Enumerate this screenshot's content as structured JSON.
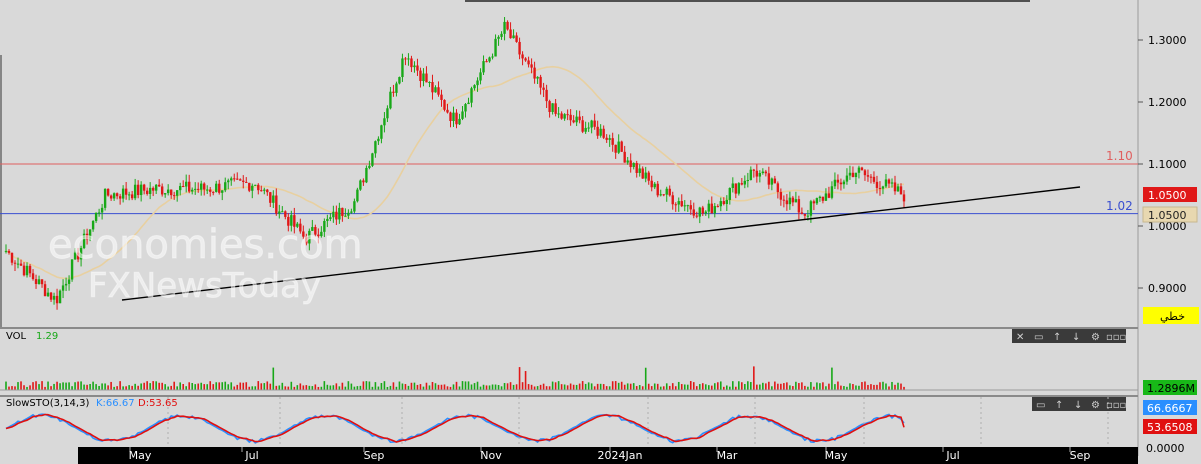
{
  "watermark": {
    "line1": "economies.com",
    "line2": "FXNewsToday"
  },
  "price_panel": {
    "ylim": [
      0.85,
      1.33
    ],
    "y_ticks": [
      "1.3000",
      "1.2000",
      "1.1000",
      "1.0000",
      "0.9000"
    ],
    "resistance": {
      "label": "1.10",
      "value": 1.1,
      "color": "#e06060"
    },
    "support": {
      "label": "1.02",
      "value": 1.02,
      "color": "#3a4fd0"
    },
    "last_price_badge": "1.0500",
    "last_price_badge2": "1.0500",
    "chart_type_button": "خطي"
  },
  "volume_panel": {
    "label": "VOL",
    "value": "1.29",
    "badge": "1.2896M"
  },
  "stoch_panel": {
    "label": "SlowSTO(3,14,3)",
    "k_text": "K:66.67",
    "d_text": "D:53.65",
    "k_badge": "66.6667",
    "d_badge": "53.6508",
    "zero_label": "0.0000",
    "k_color": "#2a8fff",
    "d_color": "#e01010"
  },
  "x_axis": {
    "labels": [
      "May",
      "Jul",
      "Sep",
      "Nov",
      "2024Jan",
      "Mar",
      "May",
      "Jul",
      "Sep"
    ]
  },
  "colors": {
    "up": "#18a818",
    "down": "#e01818",
    "ma": "#e8d0a0",
    "trendline": "#000000"
  },
  "chart_data": {
    "type": "candlestick",
    "x_labels": [
      "May",
      "Jul",
      "Sep",
      "Nov",
      "2024Jan",
      "Mar",
      "May",
      "Jul",
      "Sep"
    ],
    "ylim": [
      0.85,
      1.33
    ],
    "key_points": [
      {
        "period": "early Apr",
        "close": 0.96
      },
      {
        "period": "late Apr",
        "close": 0.88
      },
      {
        "period": "May",
        "close": 1.05
      },
      {
        "period": "Jul",
        "close": 1.06
      },
      {
        "period": "Aug",
        "close": 1.06
      },
      {
        "period": "Sep",
        "close": 1.07
      },
      {
        "period": "Oct",
        "close": 0.98
      },
      {
        "period": "early Nov",
        "close": 1.04
      },
      {
        "period": "mid Nov",
        "close": 1.28
      },
      {
        "period": "Dec",
        "close": 1.17
      },
      {
        "period": "2024Jan",
        "close": 1.32
      },
      {
        "period": "late Jan",
        "close": 1.18
      },
      {
        "period": "Feb",
        "close": 1.15
      },
      {
        "period": "mid Feb",
        "close": 1.06
      },
      {
        "period": "Mar",
        "close": 1.02
      },
      {
        "period": "late Mar",
        "close": 1.09
      },
      {
        "period": "Apr",
        "close": 1.02
      },
      {
        "period": "May",
        "close": 1.09
      },
      {
        "period": "late May",
        "close": 1.05
      }
    ],
    "levels": [
      {
        "label": "1.10",
        "value": 1.1
      },
      {
        "label": "1.02",
        "value": 1.02
      }
    ],
    "last": 1.05,
    "volume_last": "1.2896M",
    "stochastic": {
      "k": 66.67,
      "d": 53.65
    }
  }
}
